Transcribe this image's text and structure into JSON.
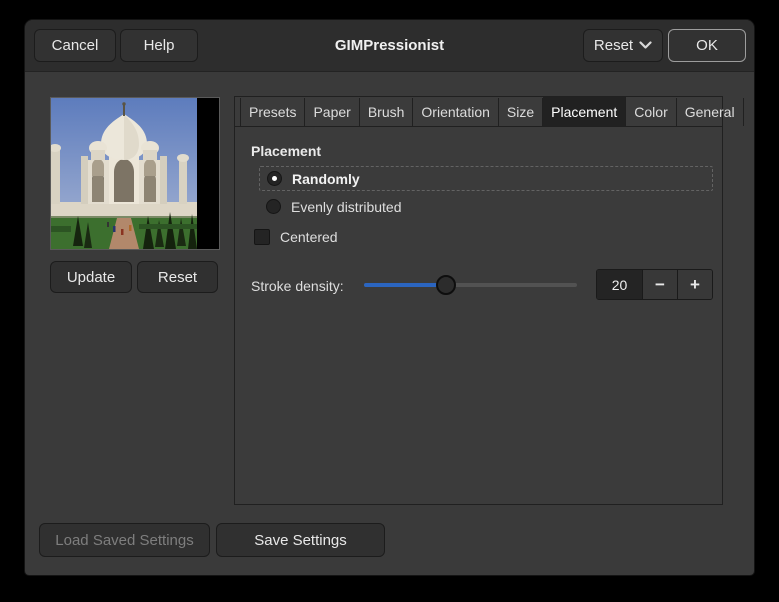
{
  "window": {
    "title": "GIMPressionist"
  },
  "header": {
    "cancel_label": "Cancel",
    "help_label": "Help",
    "reset_menu_label": "Reset",
    "ok_label": "OK"
  },
  "preview": {
    "image_alt": "taj-mahal-preview",
    "update_label": "Update",
    "reset_label": "Reset"
  },
  "tabs": [
    {
      "label": "Presets",
      "active": false
    },
    {
      "label": "Paper",
      "active": false
    },
    {
      "label": "Brush",
      "active": false
    },
    {
      "label": "Orientation",
      "active": false
    },
    {
      "label": "Size",
      "active": false
    },
    {
      "label": "Placement",
      "active": true
    },
    {
      "label": "Color",
      "active": false
    },
    {
      "label": "General",
      "active": false
    }
  ],
  "panel": {
    "heading": "Placement",
    "radios": [
      {
        "label": "Randomly",
        "selected": true,
        "focused": true
      },
      {
        "label": "Evenly distributed",
        "selected": false,
        "focused": false
      }
    ],
    "checkbox": {
      "label": "Centered",
      "checked": false
    },
    "stroke_density": {
      "label": "Stroke density:",
      "value": "20",
      "percent": 38.5,
      "minus_label": "−",
      "plus_label": "+"
    }
  },
  "footer": {
    "load_label": "Load Saved Settings",
    "load_disabled": true,
    "save_label": "Save Settings"
  },
  "colors": {
    "outer_bg": "#000000",
    "dialog_bg": "#3a3a3a",
    "header_bg": "#2d2d2d",
    "panel_border": "#202020",
    "active_tab": "#212121",
    "control_bg": "#242424",
    "accent": "#2b65c0",
    "track": "#525252",
    "text": "#e8e8e8",
    "disabled": "#7e7e7e",
    "ok_border": "#9d9d9d"
  }
}
